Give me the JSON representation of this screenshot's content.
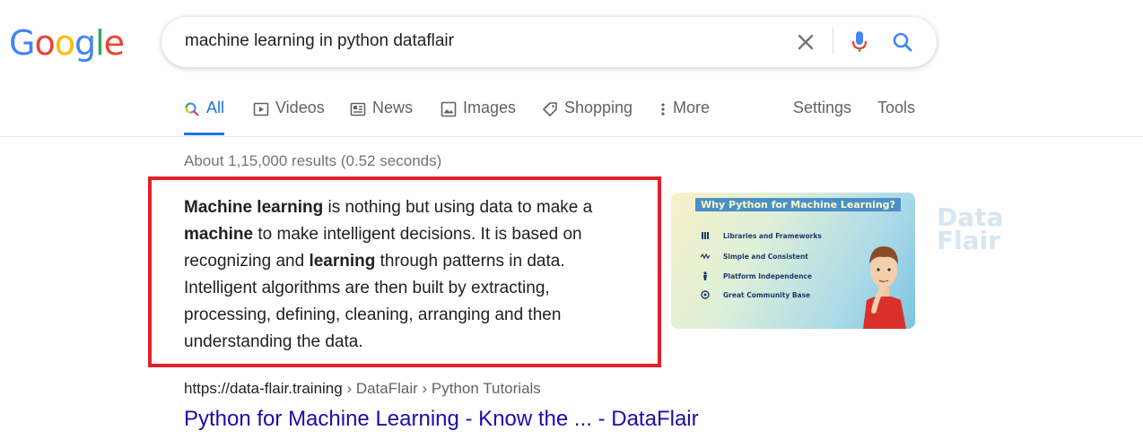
{
  "logo": {
    "letters": [
      "G",
      "o",
      "o",
      "g",
      "l",
      "e"
    ],
    "colors": [
      "#4285F4",
      "#EA4335",
      "#FBBC05",
      "#4285F4",
      "#34A853",
      "#EA4335"
    ]
  },
  "search": {
    "query": "machine learning in python dataflair"
  },
  "tabs": [
    {
      "label": "All",
      "icon": "search-icon",
      "active": true
    },
    {
      "label": "Videos",
      "icon": "video-icon"
    },
    {
      "label": "News",
      "icon": "news-icon"
    },
    {
      "label": "Images",
      "icon": "image-icon"
    },
    {
      "label": "Shopping",
      "icon": "tag-icon"
    },
    {
      "label": "More",
      "icon": "more-vert-icon"
    }
  ],
  "tools": {
    "settings": "Settings",
    "tools": "Tools"
  },
  "stats": "About 1,15,000 results (0.52 seconds)",
  "featured_snippet": {
    "segments": [
      {
        "text": "Machine learning",
        "bold": true
      },
      {
        "text": " is nothing but using data to make a ",
        "bold": false
      },
      {
        "text": "machine",
        "bold": true
      },
      {
        "text": " to make intelligent decisions. It is based on recognizing and ",
        "bold": false
      },
      {
        "text": "learning",
        "bold": true
      },
      {
        "text": " through patterns in data. Intelligent algorithms are then built by extracting, processing, defining, cleaning, arranging and then understanding the data.",
        "bold": false
      }
    ],
    "highlight_color": "#e0212b"
  },
  "thumbnail": {
    "title": "Why Python for Machine Learning?",
    "items": [
      "Libraries and Frameworks",
      "Simple and Consistent",
      "Platform Independence",
      "Great Community Base"
    ]
  },
  "result": {
    "url_host": "https://data-flair.training",
    "breadcrumbs": [
      "DataFlair",
      "Python Tutorials"
    ],
    "title": "Python for Machine Learning - Know the ... - DataFlair"
  },
  "colors": {
    "accent": "#1a73e8",
    "link": "#1a0dab"
  }
}
